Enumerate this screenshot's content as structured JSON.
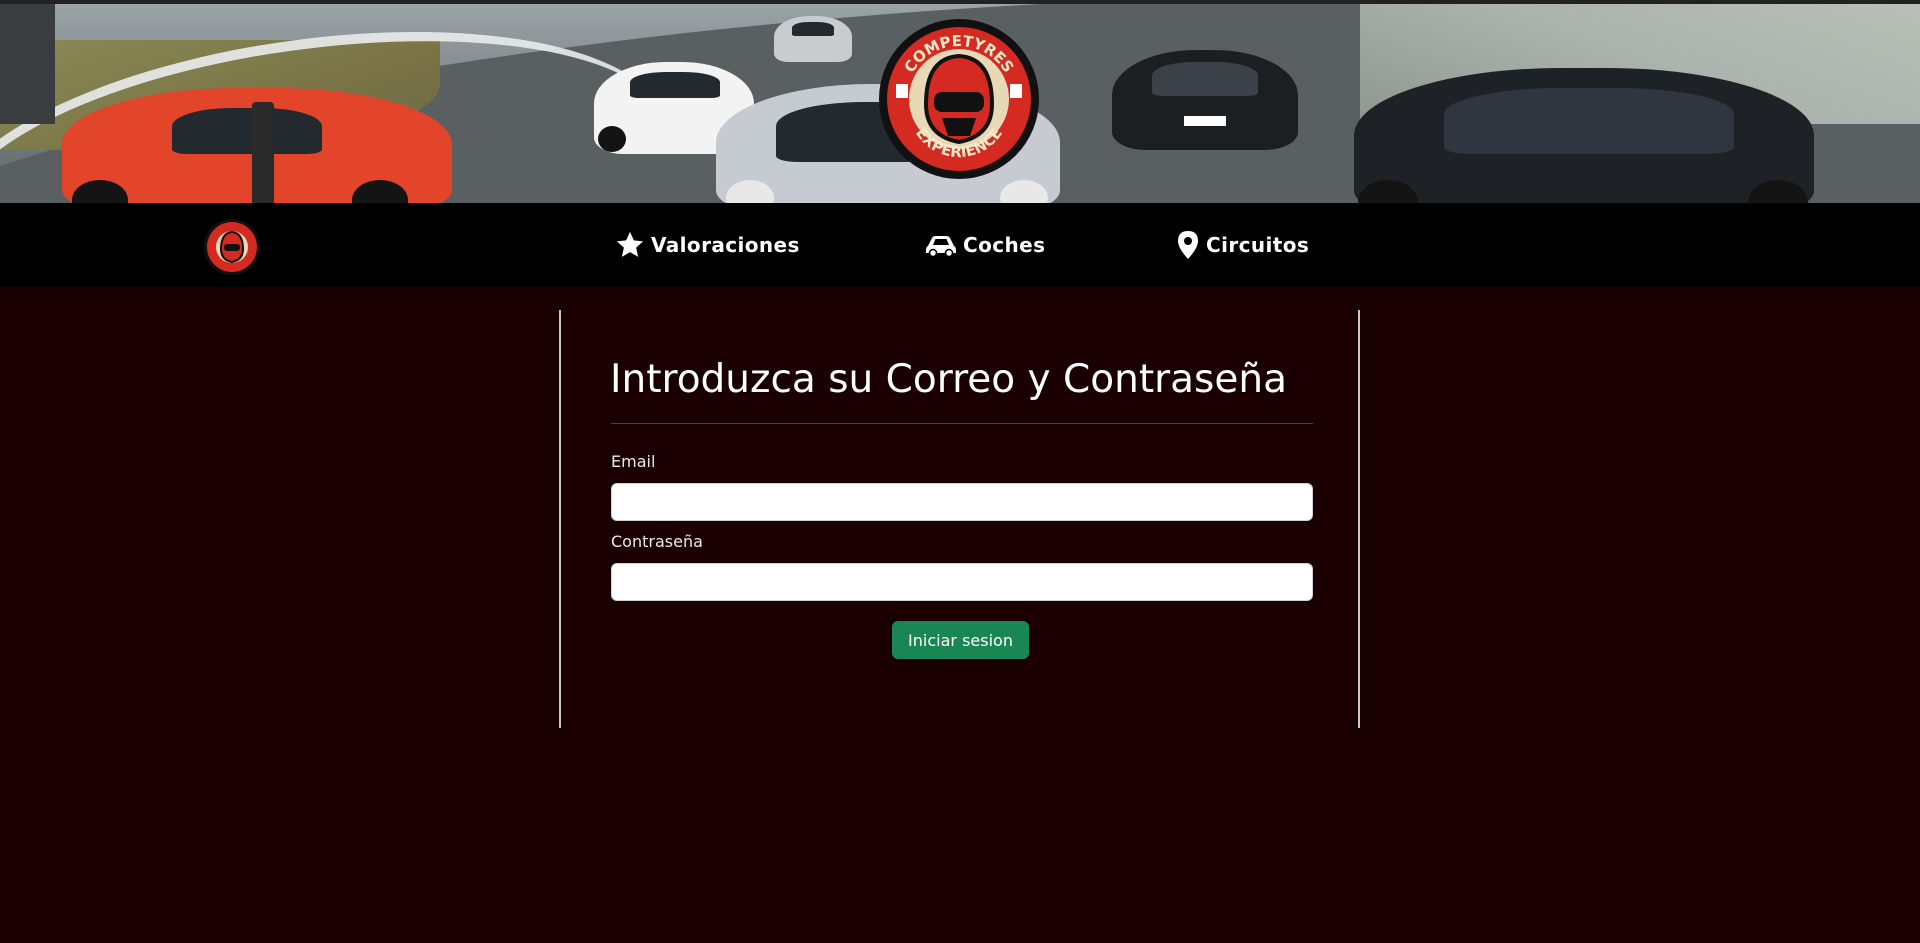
{
  "banner": {
    "logo_alt_text": "COMPETYRES EXPERIENCE"
  },
  "nav": {
    "logo_alt_text": "COMPETYRES EXPERIENCE",
    "items": [
      {
        "label": "Valoraciones",
        "icon": "star-icon"
      },
      {
        "label": "Coches",
        "icon": "car-icon"
      },
      {
        "label": "Circuitos",
        "icon": "map-pin-icon"
      }
    ]
  },
  "login": {
    "title": "Introduzca su Correo y Contraseña",
    "email_label": "Email",
    "email_value": "",
    "password_label": "Contraseña",
    "password_value": "",
    "submit_label": "Iniciar sesion"
  },
  "colors": {
    "page_background": "#1a0000",
    "navbar_background": "#000000",
    "submit_button": "#198754",
    "logo_red": "#d42a22"
  }
}
